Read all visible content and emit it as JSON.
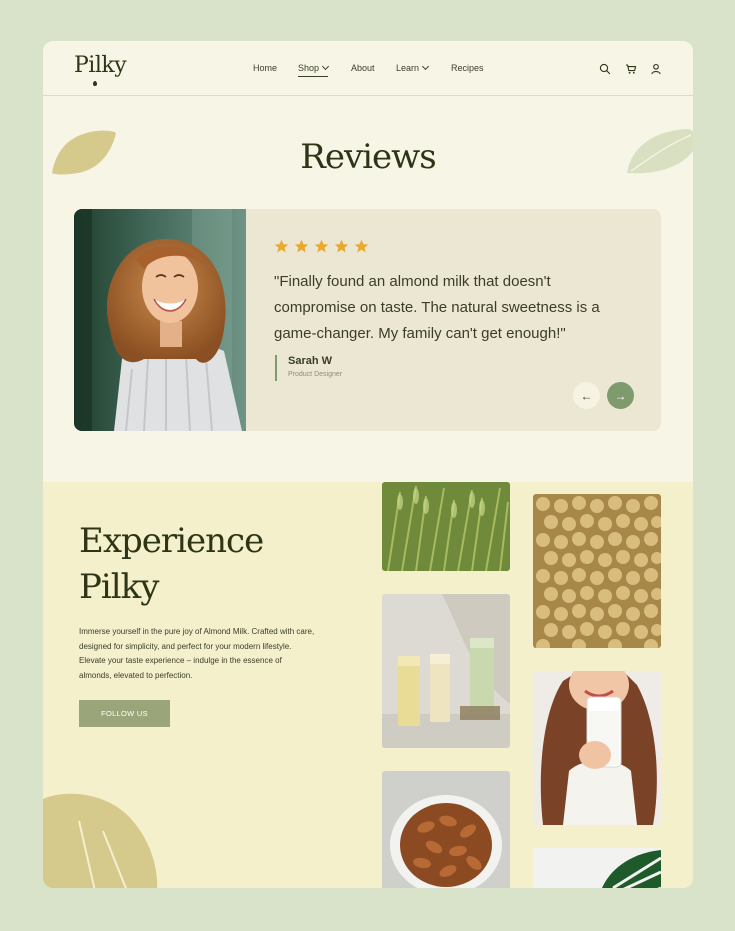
{
  "brand": {
    "name": "Pilky"
  },
  "nav": {
    "items": [
      {
        "label": "Home"
      },
      {
        "label": "Shop"
      },
      {
        "label": "About"
      },
      {
        "label": "Learn"
      },
      {
        "label": "Recipes"
      }
    ]
  },
  "header_icons": [
    "search-icon",
    "cart-icon",
    "user-icon"
  ],
  "reviews": {
    "title": "Reviews",
    "rating": 5,
    "quote": "\"Finally found an almond milk that doesn't compromise on taste. The natural sweetness is a game-changer. My family can't get enough!\"",
    "author_name": "Sarah W",
    "author_role": "Product Designer",
    "prev_icon": "←",
    "next_icon": "→"
  },
  "experience": {
    "title_line1": "Experience",
    "title_line2": "Pilky",
    "description": "Immerse yourself in the pure joy of Almond Milk. Crafted with care, designed for simplicity, and perfect for your modern lifestyle. Elevate your taste experience – indulge in the essence of almonds, elevated to perfection.",
    "button_label": "FOLLOW US"
  },
  "colors": {
    "page_bg": "#d8e3c9",
    "card_bg": "#f6f5e6",
    "review_bg": "#ece7d3",
    "experience_bg": "#f4f0cc",
    "accent_green": "#7f9a6c",
    "star": "#eda72b",
    "text_dark": "#2e3516"
  }
}
